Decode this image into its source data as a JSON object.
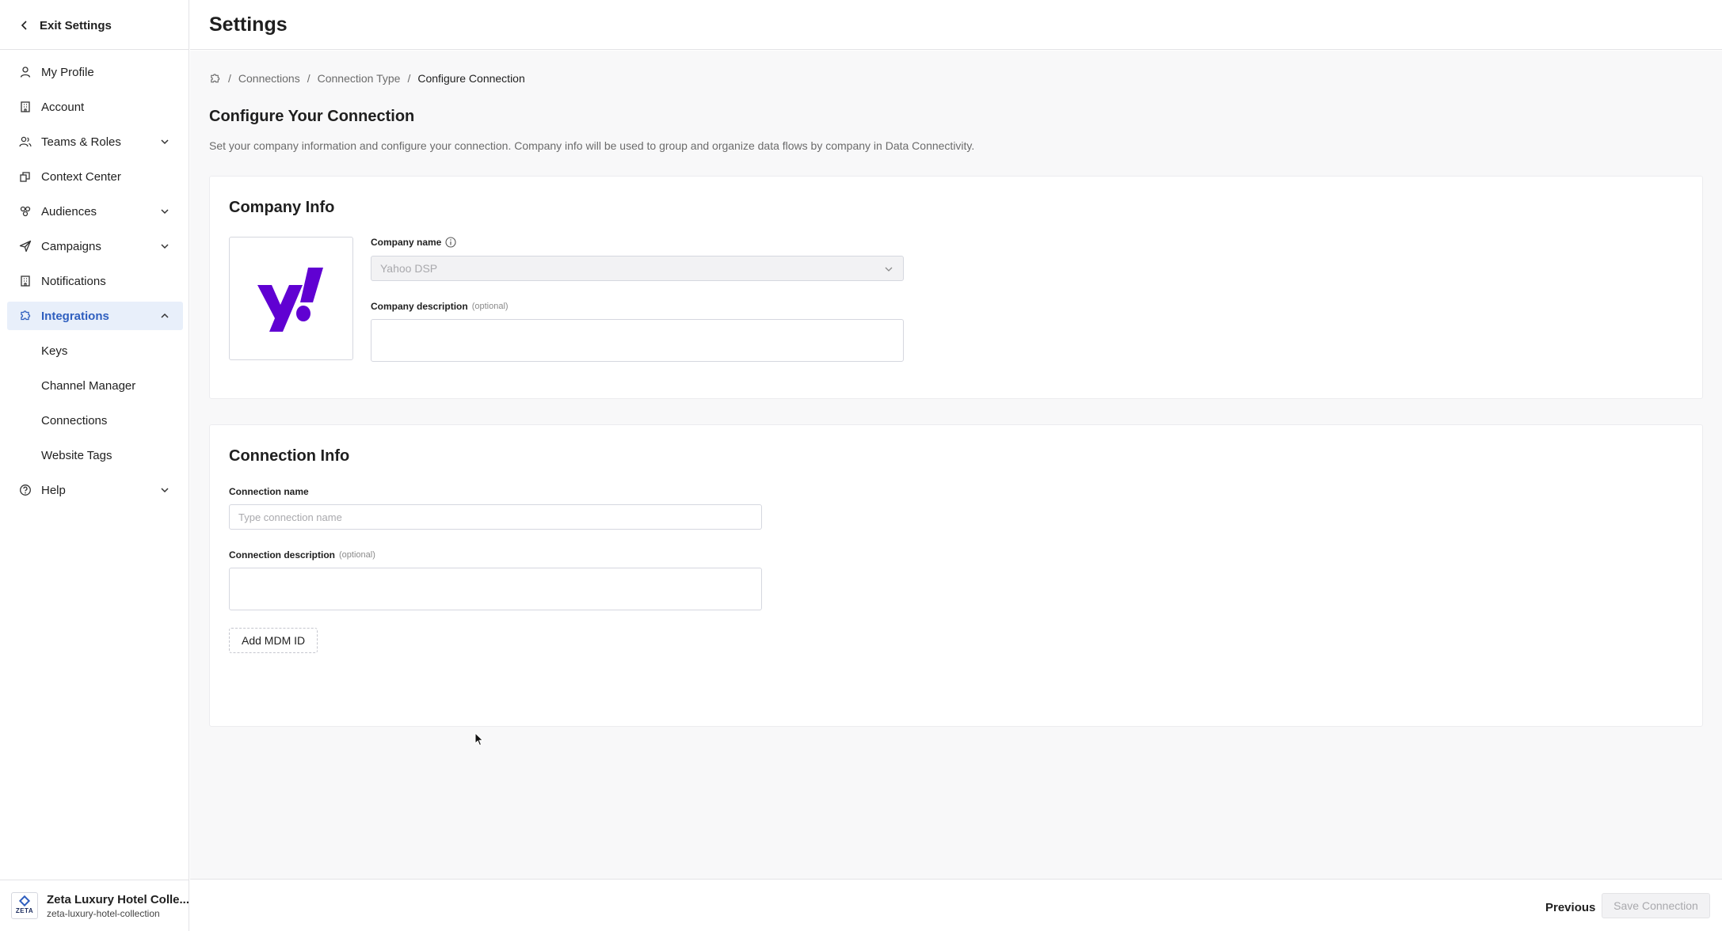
{
  "sidebar": {
    "exit_label": "Exit Settings",
    "items": [
      {
        "label": "My Profile",
        "icon": "user-icon"
      },
      {
        "label": "Account",
        "icon": "building-icon"
      },
      {
        "label": "Teams & Roles",
        "icon": "users-icon",
        "expandable": true
      },
      {
        "label": "Context Center",
        "icon": "layers-icon"
      },
      {
        "label": "Audiences",
        "icon": "audience-icon",
        "expandable": true
      },
      {
        "label": "Campaigns",
        "icon": "send-icon",
        "expandable": true
      },
      {
        "label": "Notifications",
        "icon": "bell-icon"
      },
      {
        "label": "Integrations",
        "icon": "puzzle-icon",
        "expandable": true,
        "active": true
      },
      {
        "label": "Help",
        "icon": "help-icon",
        "expandable": true
      }
    ],
    "sub_items": [
      "Keys",
      "Channel Manager",
      "Connections",
      "Website Tags"
    ],
    "org": {
      "name": "Zeta Luxury Hotel Colle...",
      "slug": "zeta-luxury-hotel-collection",
      "logo_text": "ZETA"
    }
  },
  "header": {
    "title": "Settings"
  },
  "breadcrumb": {
    "items": [
      "Connections",
      "Connection Type"
    ],
    "current": "Configure Connection"
  },
  "page": {
    "title": "Configure Your Connection",
    "description": "Set your company information and configure your connection. Company info will be used to group and organize data flows by company in Data Connectivity."
  },
  "company_info": {
    "title": "Company Info",
    "name_label": "Company name",
    "name_value": "Yahoo DSP",
    "description_label": "Company description",
    "optional": "(optional)",
    "logo_color": "#6001D2"
  },
  "connection_info": {
    "title": "Connection Info",
    "name_label": "Connection name",
    "name_placeholder": "Type connection name",
    "description_label": "Connection description",
    "optional": "(optional)",
    "add_mdm_label": "Add MDM ID"
  },
  "footer": {
    "previous_label": "Previous",
    "save_label": "Save Connection"
  },
  "colors": {
    "accent": "#2F5FBF",
    "active_bg": "#E8EFFA"
  }
}
